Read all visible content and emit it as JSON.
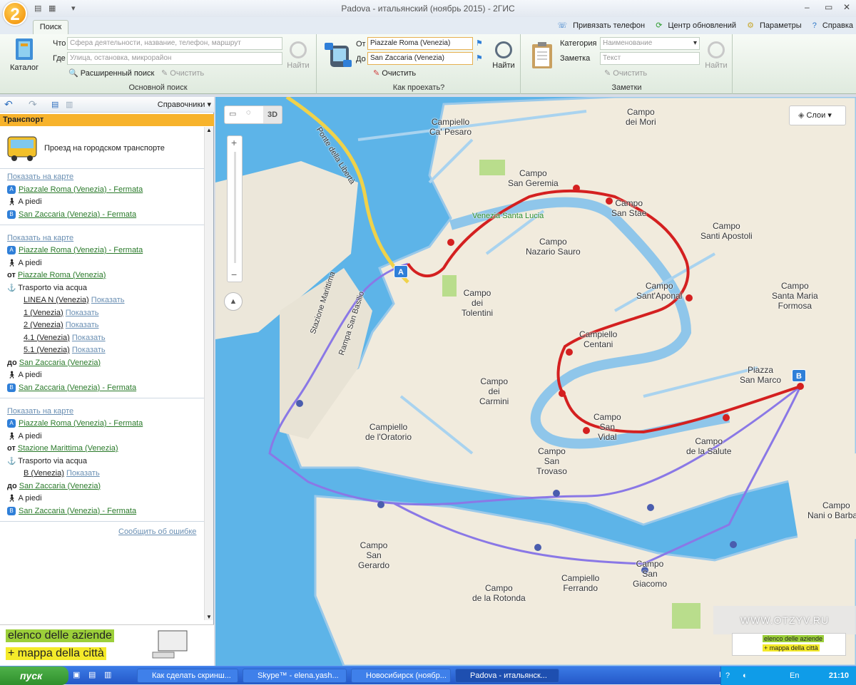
{
  "window": {
    "title": "Padova - итальянский (ноябрь 2015) - 2ГИС",
    "logo_text": "2",
    "quick_access": [
      "▤",
      "▦",
      "▾"
    ],
    "min": "–",
    "max": "▭",
    "close": "✕"
  },
  "ribbon": {
    "tab": "Поиск",
    "top_links": [
      "Привязать телефон",
      "Центр обновлений",
      "Параметры",
      "Справка"
    ],
    "main_search": {
      "catalog_label": "Каталог",
      "what_label": "Что",
      "what_placeholder": "Сфера деятельности, название, телефон, маршрут",
      "where_label": "Где",
      "where_placeholder": "Улица, остановка, микрорайон",
      "find_label": "Найти",
      "advanced_label": "Расширенный поиск",
      "clear_label": "Очистить",
      "group_label": "Основной поиск"
    },
    "route": {
      "from_label": "От",
      "from_value": "Piazzale Roma (Venezia)",
      "to_label": "До",
      "to_value": "San Zaccaria (Venezia)",
      "find_label": "Найти",
      "clear_label": "Очистить",
      "group_label": "Как проехать?"
    },
    "notes": {
      "category_label": "Категория",
      "category_placeholder": "Наименование",
      "note_label": "Заметка",
      "note_placeholder": "Текст",
      "clear_label": "Очистить",
      "find_label": "Найти",
      "group_label": "Заметки"
    }
  },
  "sidebar": {
    "toolbar_right": "Справочники",
    "header": "Транспорт",
    "transport_title": "Проезд на городском транспорте",
    "routes": [
      {
        "show_map": "Показать на карте",
        "lines": [
          {
            "kind": "A",
            "text": "Piazzale Roma (Venezia) - Fermata"
          },
          {
            "kind": "walk",
            "text": "A piedi"
          },
          {
            "kind": "B",
            "text": "San Zaccaria (Venezia) - Fermata"
          }
        ]
      },
      {
        "show_map": "Показать на карте",
        "lines": [
          {
            "kind": "A",
            "text": "Piazzale Roma (Venezia) - Fermata"
          },
          {
            "kind": "walk",
            "text": "A piedi"
          },
          {
            "kind": "from",
            "prefix": "от",
            "text": "Piazzale Roma (Venezia)"
          },
          {
            "kind": "boat",
            "text": "Trasporto via acqua"
          },
          {
            "kind": "line",
            "text": "LINEA N (Venezia)",
            "action": "Показать"
          },
          {
            "kind": "line",
            "text": "1 (Venezia)",
            "action": "Показать"
          },
          {
            "kind": "line",
            "text": "2 (Venezia)",
            "action": "Показать"
          },
          {
            "kind": "line",
            "text": "4.1 (Venezia)",
            "action": "Показать"
          },
          {
            "kind": "line",
            "text": "5.1 (Venezia)",
            "action": "Показать"
          },
          {
            "kind": "to",
            "prefix": "до",
            "text": "San Zaccaria (Venezia)"
          },
          {
            "kind": "walk",
            "text": "A piedi"
          },
          {
            "kind": "B",
            "text": "San Zaccaria (Venezia) - Fermata"
          }
        ]
      },
      {
        "show_map": "Показать на карте",
        "lines": [
          {
            "kind": "A",
            "text": "Piazzale Roma (Venezia) - Fermata"
          },
          {
            "kind": "walk",
            "text": "A piedi"
          },
          {
            "kind": "from",
            "prefix": "от",
            "text": "Stazione Marittima (Venezia)"
          },
          {
            "kind": "boat",
            "text": "Trasporto via acqua"
          },
          {
            "kind": "line",
            "text": "B (Venezia)",
            "action": "Показать"
          },
          {
            "kind": "to",
            "prefix": "до",
            "text": "San Zaccaria (Venezia)"
          },
          {
            "kind": "walk",
            "text": "A piedi"
          },
          {
            "kind": "B",
            "text": "San Zaccaria (Venezia) - Fermata"
          }
        ]
      }
    ],
    "report_error": "Сообщить об ошибке",
    "ad_line1": "elenco delle aziende",
    "ad_line2": "+ mappa della città"
  },
  "map": {
    "layers_label": "Слои",
    "mode_3d": "3D",
    "watermark": "WWW.OTZYV.RU",
    "corner_ad_line1": "elenco delle aziende",
    "corner_ad_line2": "+ mappa della città",
    "labels": [
      "Campiello\nCa' Pesaro",
      "Campo\ndei Mori",
      "Campo\nSan Geremia",
      "Campo\nSan Stae",
      "Venezia Santa Lucia",
      "Campo\nNazario Sauro",
      "Campo\nSanti Apostoli",
      "Campo\nSant'Aponal",
      "Campo\ndei\nTolentini",
      "Campo\nSanta Maria\nFormosa",
      "Campiello\nCentani",
      "Piazza\nSan Marco",
      "Campo\ndei\nCarmini",
      "Campo\nSan\nVidal",
      "Campo\nde la Salute",
      "Campiello\nde l'Oratorio",
      "Campo\nSan\nTrovaso",
      "Campo\nNani o Barbaro",
      "Campo\nSan\nGerardo",
      "Campo\nSan\nGiacomo",
      "Campiello\nFerrando",
      "Campo\nde la Rotonda",
      "Ponte della Libertà",
      "Stazione Marittima",
      "Rampa San Basilio"
    ]
  },
  "taskbar": {
    "start": "пуск",
    "buttons": [
      "Как сделать скринш...",
      "Skype™ - elena.yash...",
      "Новосибирск (ноябр...",
      "Padova - итальянск..."
    ],
    "lang": "EN",
    "tray_lang": "En",
    "time": "21:10"
  }
}
